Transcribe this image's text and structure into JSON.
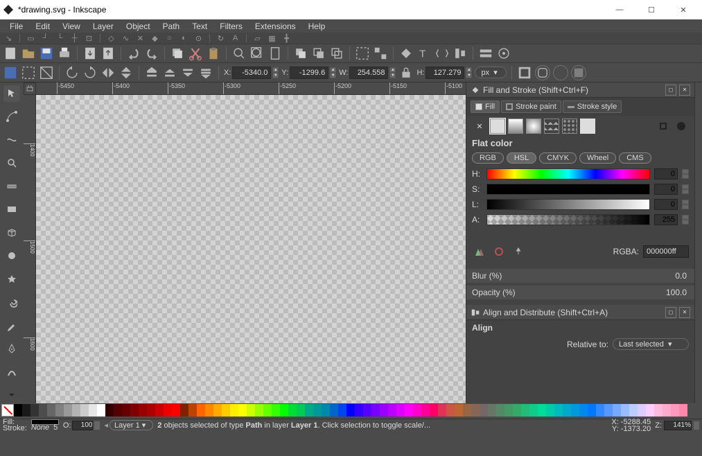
{
  "title": "*drawing.svg - Inkscape",
  "menu": [
    "File",
    "Edit",
    "View",
    "Layer",
    "Object",
    "Path",
    "Text",
    "Filters",
    "Extensions",
    "Help"
  ],
  "options": {
    "x_label": "X:",
    "x_value": "-5340.0",
    "y_label": "Y:",
    "y_value": "-1299.6",
    "w_label": "W:",
    "w_value": "254.558",
    "h_label": "H:",
    "h_value": "127.279",
    "unit": "px"
  },
  "ruler_h": [
    "-5450",
    "-5400",
    "-5350",
    "-5300",
    "-5250",
    "-5200",
    "-5150",
    "-5100"
  ],
  "ruler_v": [
    "1400",
    "1500",
    "1600"
  ],
  "fill_stroke": {
    "title": "Fill and Stroke (Shift+Ctrl+F)",
    "tabs": {
      "fill": "Fill",
      "stroke_paint": "Stroke paint",
      "stroke_style": "Stroke style"
    },
    "mode_label": "Flat color",
    "spaces": [
      "RGB",
      "HSL",
      "CMYK",
      "Wheel",
      "CMS"
    ],
    "active_space": "HSL",
    "h_label": "H:",
    "h_val": "0",
    "s_label": "S:",
    "s_val": "0",
    "l_label": "L:",
    "l_val": "0",
    "a_label": "A:",
    "a_val": "255",
    "rgba_label": "RGBA:",
    "rgba_val": "000000ff",
    "blur_label": "Blur (%)",
    "blur_val": "0.0",
    "opacity_label": "Opacity (%)",
    "opacity_val": "100.0"
  },
  "align": {
    "title": "Align and Distribute (Shift+Ctrl+A)",
    "section": "Align",
    "relative_label": "Relative to:",
    "relative_value": "Last selected"
  },
  "status": {
    "fill_label": "Fill:",
    "stroke_label": "Stroke:",
    "stroke_value": "None",
    "stroke_width": "5",
    "opacity_label": "O:",
    "opacity_value": "100",
    "layer": "Layer 1",
    "msg_prefix": "2",
    "msg_mid": " objects selected of type ",
    "msg_type": "Path",
    "msg_in": " in layer ",
    "msg_layer": "Layer 1",
    "msg_tail": ". Click selection to toggle scale/...",
    "coord_x_label": "X:",
    "coord_x": "-5288.45",
    "coord_y_label": "Y:",
    "coord_y": "-1373.20",
    "zoom_label": "Z:",
    "zoom": "141%"
  },
  "palette_colors": [
    "#000000",
    "#1a1a1a",
    "#333333",
    "#4d4d4d",
    "#666666",
    "#808080",
    "#999999",
    "#b3b3b3",
    "#cccccc",
    "#e6e6e6",
    "#ffffff",
    "#330000",
    "#550000",
    "#660000",
    "#800000",
    "#990000",
    "#aa0000",
    "#cc0000",
    "#ee0000",
    "#ff0000",
    "#802200",
    "#bb4400",
    "#ff6600",
    "#ff8800",
    "#ffaa00",
    "#ffcc00",
    "#ffee00",
    "#ffff00",
    "#ccff00",
    "#99ff00",
    "#66ff00",
    "#33ff00",
    "#00ff00",
    "#00dd33",
    "#00cc55",
    "#00aa88",
    "#009999",
    "#0088aa",
    "#0066cc",
    "#0044ee",
    "#0000ff",
    "#3300ff",
    "#5500ff",
    "#7700ff",
    "#9900ff",
    "#bb00ff",
    "#dd00ff",
    "#ff00ff",
    "#ff00cc",
    "#ff0099",
    "#ff0066",
    "#dd3355",
    "#cc5544",
    "#bb6633",
    "#996644",
    "#886655",
    "#776666",
    "#667766",
    "#558866",
    "#449966",
    "#33aa66",
    "#22bb77",
    "#11cc88",
    "#00dd99",
    "#00ccaa",
    "#00bbbb",
    "#00aacc",
    "#0099dd",
    "#0088ee",
    "#0077ff",
    "#3388ff",
    "#5599ff",
    "#77aaff",
    "#99bbff",
    "#bbccff",
    "#ddccff",
    "#ffccff",
    "#ffbbdd",
    "#ffaacc",
    "#ff99bb",
    "#ff88aa"
  ]
}
